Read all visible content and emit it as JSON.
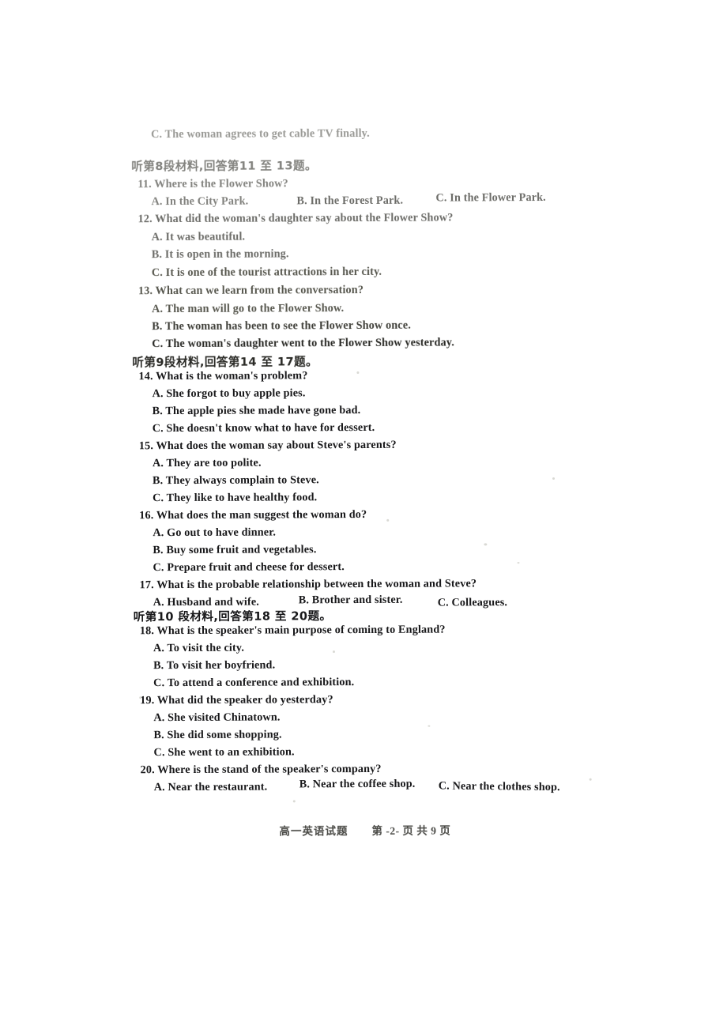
{
  "document": {
    "subject_footer_cn": "高一英语试题",
    "footer_page_label": "第 -2- 页  共 9 页"
  },
  "carryover_option": {
    "label": "C. The woman agrees to get cable TV finally."
  },
  "sections": [
    {
      "header": "听第8段材料,回答第11 至 13题。",
      "questions": [
        {
          "number": "11.",
          "text": "Where is the Flower Show?",
          "layout": "inline",
          "options": [
            "A. In the City Park.",
            "B. In the Forest Park.",
            "C. In the Flower Park."
          ]
        },
        {
          "number": "12.",
          "text": "What did the woman's daughter say about the Flower Show?",
          "layout": "stacked",
          "options": [
            "A. It was beautiful.",
            "B. It is open in the morning.",
            "C. It is one of the tourist attractions in her city."
          ]
        },
        {
          "number": "13.",
          "text": "What can we learn from the conversation?",
          "layout": "stacked",
          "options": [
            "A. The man will go to the Flower Show.",
            "B. The woman has been to see the Flower Show once.",
            "C. The woman's daughter went to the Flower Show yesterday."
          ]
        }
      ]
    },
    {
      "header": "听第9段材料,回答第14 至 17题。",
      "questions": [
        {
          "number": "14.",
          "text": "What is the woman's problem?",
          "layout": "stacked",
          "options": [
            "A. She forgot to buy apple pies.",
            "B. The apple pies she made have gone bad.",
            "C. She doesn't know what to have for dessert."
          ]
        },
        {
          "number": "15.",
          "text": "What does the woman say about Steve's parents?",
          "layout": "stacked",
          "options": [
            "A. They are too polite.",
            "B. They always complain to Steve.",
            "C. They like to have healthy food."
          ]
        },
        {
          "number": "16.",
          "text": "What does the man suggest the woman do?",
          "layout": "stacked",
          "options": [
            "A. Go out to have dinner.",
            "B. Buy some fruit and vegetables.",
            "C. Prepare fruit and cheese for dessert."
          ]
        },
        {
          "number": "17.",
          "text": "What is the probable relationship between the woman and Steve?",
          "layout": "inline",
          "options": [
            "A. Husband and wife.",
            "B. Brother and sister.",
            "C. Colleagues."
          ]
        }
      ]
    },
    {
      "header": "听第10 段材料,回答第18 至 20题。",
      "questions": [
        {
          "number": "18.",
          "text": "What is the speaker's main purpose of coming to England?",
          "layout": "stacked",
          "options": [
            "A. To visit the city.",
            "B. To visit her boyfriend.",
            "C. To attend a conference and exhibition."
          ]
        },
        {
          "number": "19.",
          "text": "What did the speaker do yesterday?",
          "layout": "stacked",
          "options": [
            "A. She visited Chinatown.",
            "B. She did some shopping.",
            "C. She went to an exhibition."
          ]
        },
        {
          "number": "20.",
          "text": "Where is the stand of the speaker's company?",
          "layout": "inline",
          "options": [
            "A. Near the restaurant.",
            "B. Near the coffee shop.",
            "C. Near the clothes shop."
          ]
        }
      ]
    }
  ]
}
